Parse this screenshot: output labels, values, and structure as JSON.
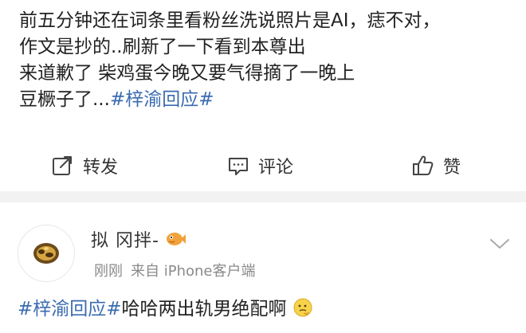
{
  "post1": {
    "lines": [
      "前五分钟还在词条里看粉丝洗说照片是AI，痣不对，",
      "作文是抄的..刷新了一下看到本尊出",
      "来道歉了 柴鸡蛋今晚又要气得摘了一晚上",
      "豆橛子了..."
    ],
    "hashtag": "#梓渝回应#",
    "actions": {
      "repost": "转发",
      "comment": "评论",
      "like": "赞"
    }
  },
  "post2": {
    "username": "拟   冈拌-",
    "meta_time": "刚刚",
    "meta_source": "来自 iPhone客户端",
    "hashtag": "#梓渝回应#",
    "text": "哈哈两出轨男绝配啊"
  },
  "colors": {
    "link": "#3b6bb0",
    "separator": "#f2f2f2",
    "meta": "#8a8a8a"
  }
}
